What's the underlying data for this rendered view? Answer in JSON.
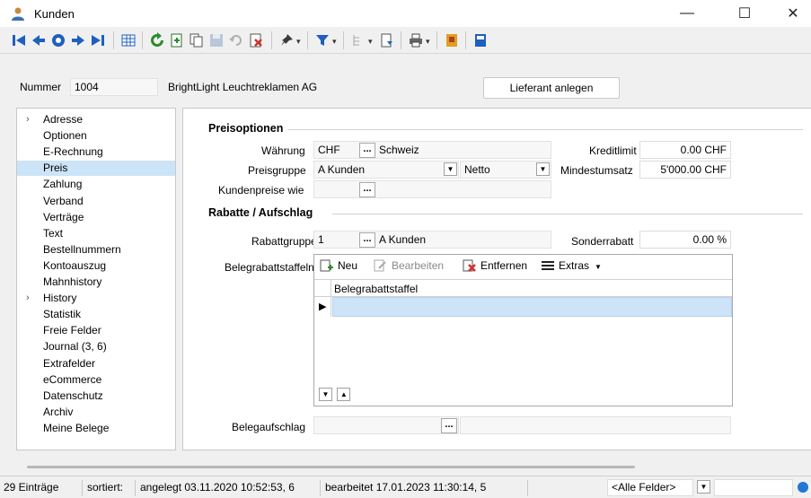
{
  "window": {
    "title": "Kunden",
    "minimize": "—",
    "maximize": "☐",
    "close": "✕"
  },
  "header": {
    "nummer_label": "Nummer",
    "nummer_value": "1004",
    "name_value": "BrightLight Leuchtreklamen AG",
    "lieferant_button": "Lieferant anlegen"
  },
  "sidebar": {
    "items": [
      {
        "label": "Adresse",
        "expandable": true
      },
      {
        "label": "Optionen"
      },
      {
        "label": "E-Rechnung"
      },
      {
        "label": "Preis",
        "selected": true
      },
      {
        "label": "Zahlung"
      },
      {
        "label": "Verband"
      },
      {
        "label": "Verträge"
      },
      {
        "label": "Text"
      },
      {
        "label": "Bestellnummern"
      },
      {
        "label": "Kontoauszug"
      },
      {
        "label": "Mahnhistory"
      },
      {
        "label": "History",
        "expandable": true
      },
      {
        "label": "Statistik"
      },
      {
        "label": "Freie Felder"
      },
      {
        "label": "Journal (3, 6)"
      },
      {
        "label": "Extrafelder"
      },
      {
        "label": "eCommerce"
      },
      {
        "label": "Datenschutz"
      },
      {
        "label": "Archiv"
      },
      {
        "label": "Meine Belege"
      }
    ]
  },
  "preisoptionen": {
    "title": "Preisoptionen",
    "waehrung_label": "Währung",
    "waehrung_value": "CHF",
    "waehrung_name": "Schweiz",
    "preisgruppe_label": "Preisgruppe",
    "preisgruppe_value": "A Kunden",
    "netto_value": "Netto",
    "kundenpreise_label": "Kundenpreise wie",
    "kreditlimit_label": "Kreditlimit",
    "kreditlimit_value": "0.00 CHF",
    "mindestumsatz_label": "Mindestumsatz",
    "mindestumsatz_value": "5'000.00 CHF"
  },
  "rabatte": {
    "title": "Rabatte / Aufschlag",
    "rabattgruppe_label": "Rabattgruppe",
    "rabattgruppe_value": "1",
    "rabattgruppe_name": "A Kunden",
    "sonderrabatt_label": "Sonderrabatt",
    "sonderrabatt_value": "0.00 %",
    "belegrabatt_label": "Belegrabattstaffeln",
    "belegaufschlag_label": "Belegaufschlag",
    "dots": "..."
  },
  "grid": {
    "neu": "Neu",
    "bearbeiten": "Bearbeiten",
    "entfernen": "Entfernen",
    "extras": "Extras",
    "column_header": "Belegrabattstaffel",
    "row_marker": "▶"
  },
  "status": {
    "count": "29 Einträge",
    "sortiert": "sortiert:",
    "angelegt": "angelegt 03.11.2020 10:52:53,  6",
    "bearbeitet": "bearbeitet 17.01.2023 11:30:14,  5",
    "felder": "<Alle Felder>"
  },
  "colors": {
    "accent_blue": "#1f5fbf",
    "selection": "#cce4f7",
    "row_selection": "#cde3f8",
    "green": "#2e8b2e",
    "red": "#d03030"
  }
}
